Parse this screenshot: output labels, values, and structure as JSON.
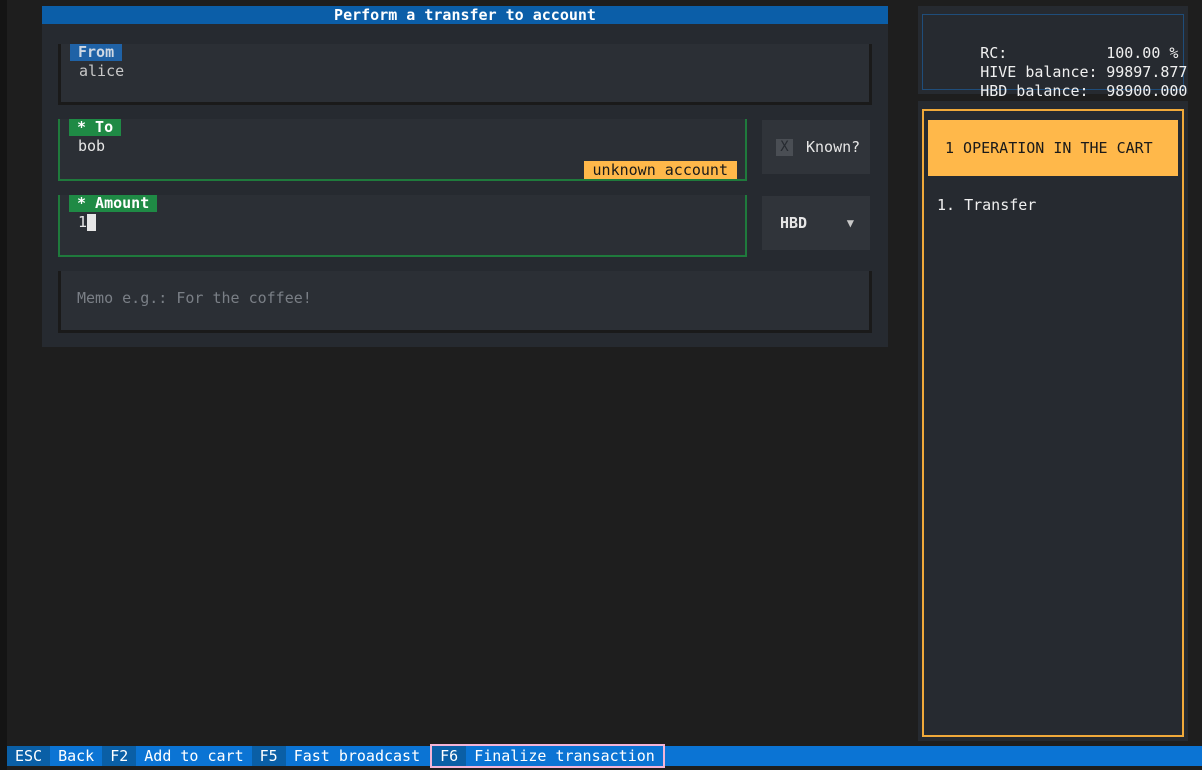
{
  "panel": {
    "title": "Perform a transfer to account"
  },
  "form": {
    "from": {
      "label": "From",
      "value": "alice"
    },
    "to": {
      "label": "* To",
      "value": "bob",
      "badge": "unknown account"
    },
    "known": {
      "checkbox_mark": "X",
      "label": "Known?"
    },
    "amount": {
      "label": "* Amount",
      "value": "1"
    },
    "currency": {
      "selected": "HBD",
      "arrow_icon": "▼"
    },
    "memo": {
      "placeholder": "Memo e.g.: For the coffee!"
    }
  },
  "balances": {
    "rows": [
      {
        "key": "RC:",
        "value": "100.00 %"
      },
      {
        "key": "HIVE balance:",
        "value": "99897.877"
      },
      {
        "key": "HBD balance:",
        "value": "98900.000"
      }
    ]
  },
  "cart": {
    "header": "1 OPERATION IN THE CART",
    "items": [
      "1. Transfer"
    ]
  },
  "footer": {
    "bindings": [
      {
        "key": "ESC",
        "action": "Back"
      },
      {
        "key": "F2",
        "action": "Add to cart"
      },
      {
        "key": "F5",
        "action": "Fast broadcast"
      },
      {
        "key": "F6",
        "action": "Finalize transaction"
      }
    ]
  },
  "colors": {
    "title_bar": "#0b5ea8",
    "valid_label": "#1f8a45",
    "warning": "#ffb84a",
    "footer": "#0b74d4",
    "highlight_outline": "#f3b4d6"
  }
}
